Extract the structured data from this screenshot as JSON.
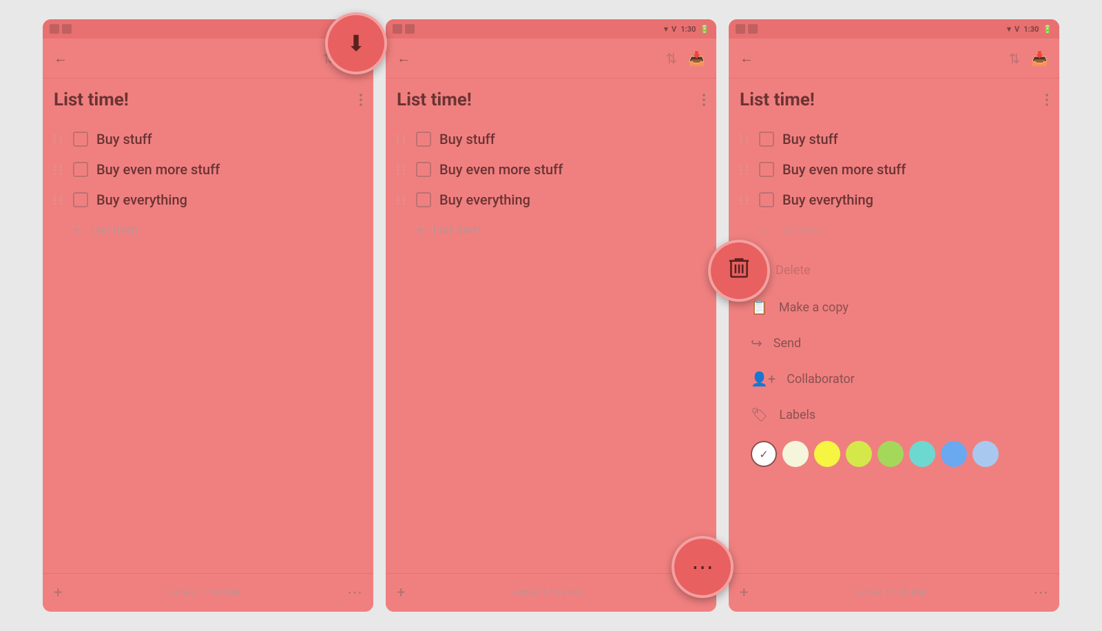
{
  "app": {
    "title": "List time!",
    "edited_label": "Edited 12:39 PM",
    "status_time": "1:30"
  },
  "list_items": [
    {
      "id": 1,
      "text": "Buy stuff"
    },
    {
      "id": 2,
      "text": "Buy even more stuff"
    },
    {
      "id": 3,
      "text": "Buy everything"
    }
  ],
  "add_item_placeholder": "List item",
  "toolbar": {
    "back_label": "←",
    "more_label": "⋮"
  },
  "bottom_bar": {
    "add_label": "+",
    "more_label": "⋯"
  },
  "fab_phone1": {
    "icon": "⬇",
    "label": "archive-fab"
  },
  "fab_phone2": {
    "icon": "⋯",
    "label": "more-fab"
  },
  "fab_phone3": {
    "icon": "🗑",
    "label": "delete-fab"
  },
  "menu_items": [
    {
      "icon": "🗑",
      "text": "Delete",
      "name": "delete-menu-item"
    },
    {
      "icon": "📋",
      "text": "Make a copy",
      "name": "make-copy-menu-item"
    },
    {
      "icon": "↪",
      "text": "Send",
      "name": "send-menu-item"
    },
    {
      "icon": "👤",
      "text": "Collaborator",
      "name": "collaborator-menu-item"
    },
    {
      "icon": "🏷",
      "text": "Labels",
      "name": "labels-menu-item"
    }
  ],
  "color_swatches": [
    {
      "color": "white",
      "class": "swatch-white",
      "selected": true
    },
    {
      "color": "cream",
      "class": "swatch-cream",
      "selected": false
    },
    {
      "color": "yellow",
      "class": "swatch-yellow",
      "selected": false
    },
    {
      "color": "lime",
      "class": "swatch-lime",
      "selected": false
    },
    {
      "color": "green",
      "class": "swatch-green",
      "selected": false
    },
    {
      "color": "teal",
      "class": "swatch-teal",
      "selected": false
    },
    {
      "color": "blue",
      "class": "swatch-blue",
      "selected": false
    },
    {
      "color": "lightblue",
      "class": "swatch-lightblue",
      "selected": false
    }
  ]
}
